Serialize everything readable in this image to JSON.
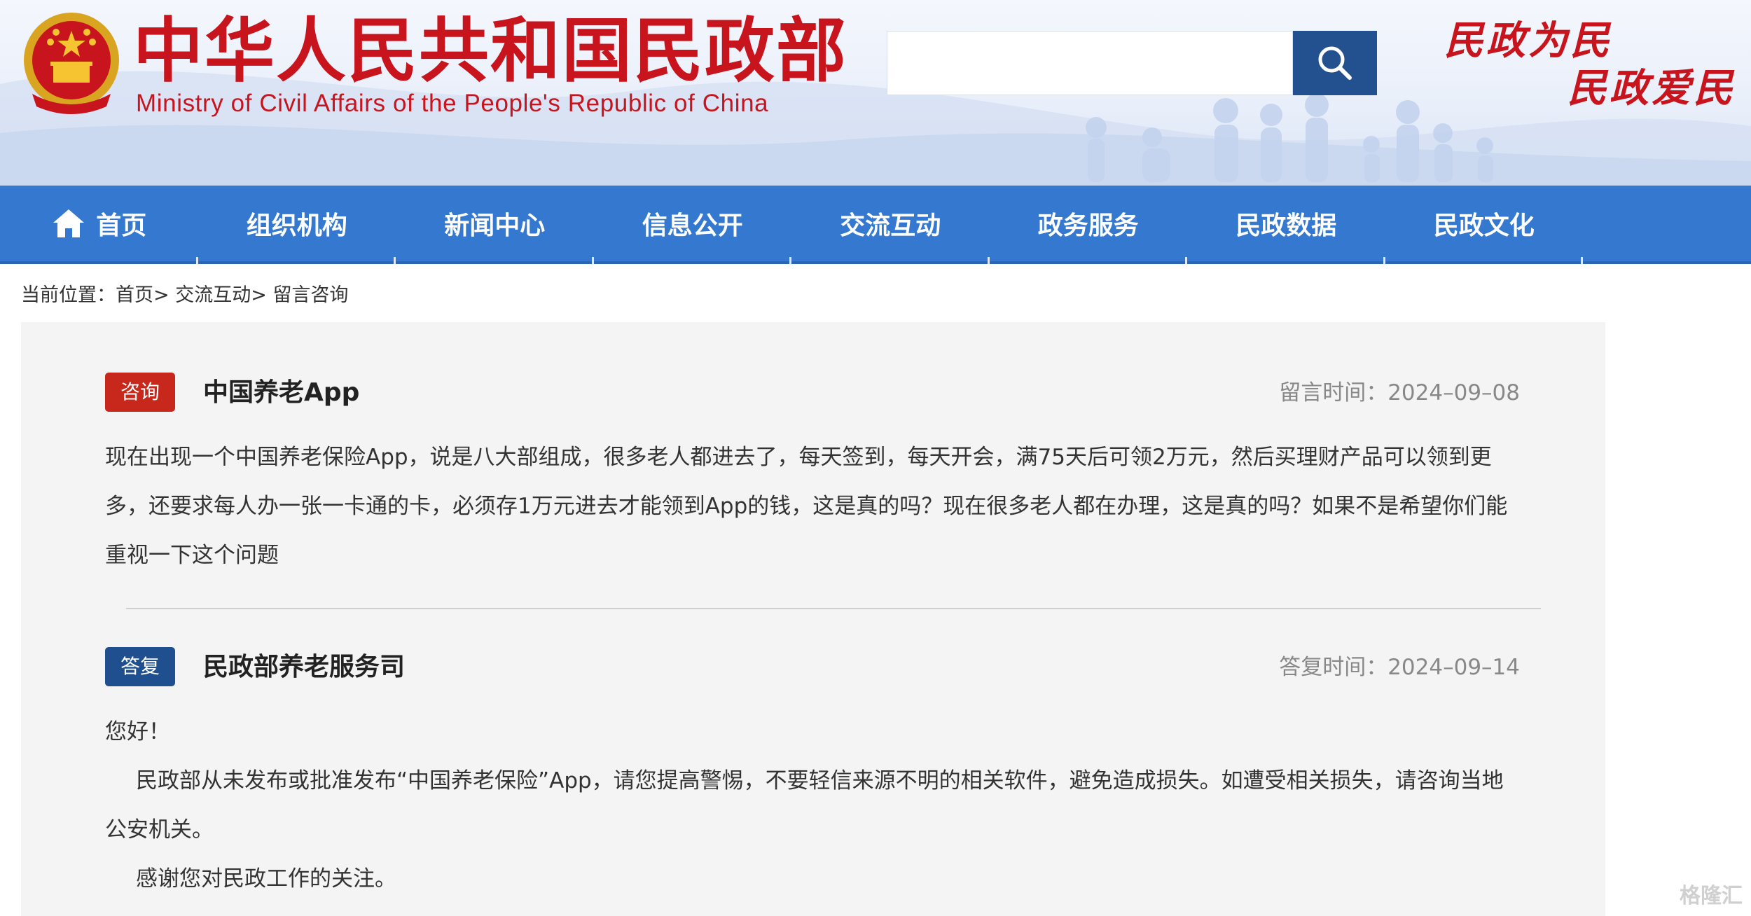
{
  "header": {
    "title": "中华人民共和国民政部",
    "subtitle": "Ministry of Civil Affairs of the People's Republic of China",
    "search_placeholder": "",
    "slogan_line1": "民政为民",
    "slogan_line2": "民政爱民"
  },
  "nav": {
    "items": [
      {
        "label": "首页",
        "icon": "home-icon"
      },
      {
        "label": "组织机构"
      },
      {
        "label": "新闻中心"
      },
      {
        "label": "信息公开"
      },
      {
        "label": "交流互动"
      },
      {
        "label": "政务服务"
      },
      {
        "label": "民政数据"
      },
      {
        "label": "民政文化"
      }
    ]
  },
  "breadcrumb": {
    "prefix": "当前位置：",
    "items": [
      "首页",
      "交流互动",
      "留言咨询"
    ],
    "separator": ">"
  },
  "question": {
    "tag": "咨询",
    "title": "中国养老App",
    "time_label": "留言时间：2024–09–08",
    "body": "现在出现一个中国养老保险App，说是八大部组成，很多老人都进去了，每天签到，每天开会，满75天后可领2万元，然后买理财产品可以领到更多，还要求每人办一张一卡通的卡，必须存1万元进去才能领到App的钱，这是真的吗？现在很多老人都在办理，这是真的吗？如果不是希望你们能重视一下这个问题"
  },
  "answer": {
    "tag": "答复",
    "title": "民政部养老服务司",
    "time_label": "答复时间：2024–09–14",
    "greeting": "您好！",
    "body": "民政部从未发布或批准发布“中国养老保险”App，请您提高警惕，不要轻信来源不明的相关软件，避免造成损失。如遭受相关损失，请咨询当地公安机关。",
    "closing": "感谢您对民政工作的关注。"
  },
  "watermark": "格隆汇",
  "colors": {
    "brand_red": "#c8151d",
    "nav_blue": "#3478d0",
    "search_button": "#23508f",
    "tag_red": "#c8281c",
    "tag_blue": "#1f4f8f"
  }
}
